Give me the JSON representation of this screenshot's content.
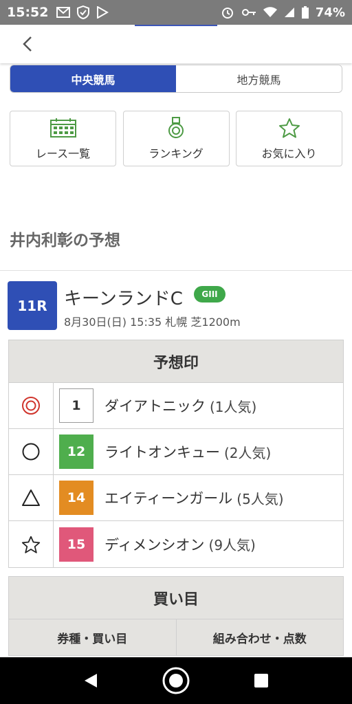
{
  "status_bar": {
    "time": "15:52",
    "battery": "74%",
    "icons": [
      "mail-icon",
      "shield-check-icon",
      "play-store-icon",
      "alarm-icon",
      "key-icon",
      "wifi-icon",
      "signal-icon",
      "battery-icon"
    ]
  },
  "app_bar": {
    "back_icon": "chevron-left-icon"
  },
  "segment": {
    "active_label": "中央競馬",
    "inactive_label": "地方競馬"
  },
  "quick_buttons": [
    {
      "label": "レース一覧",
      "icon": "calendar-icon"
    },
    {
      "label": "ランキング",
      "icon": "medal-icon"
    },
    {
      "label": "お気に入り",
      "icon": "star-outline-icon"
    }
  ],
  "section_title": "井内利彰の予想",
  "race": {
    "number": "11R",
    "name": "キーンランドC",
    "grade": "GIII",
    "meta": "8月30日(日) 15:35 札幌 芝1200m",
    "badge_color": "#2f4fb5",
    "grade_color": "#3fa84a"
  },
  "prediction": {
    "title": "予想印",
    "rows": [
      {
        "mark": "double-circle-icon",
        "number": "1",
        "horse": "ダイアトニック",
        "popularity": "(1人気)",
        "num_bg": "#ffffff",
        "num_fg": "#333333"
      },
      {
        "mark": "circle-icon",
        "number": "12",
        "horse": "ライトオンキュー",
        "popularity": "(2人気)",
        "num_bg": "#4fae4d",
        "num_fg": "#ffffff"
      },
      {
        "mark": "triangle-icon",
        "number": "14",
        "horse": "エイティーンガール",
        "popularity": "(5人気)",
        "num_bg": "#e38c22",
        "num_fg": "#ffffff"
      },
      {
        "mark": "star-icon",
        "number": "15",
        "horse": "ディメンシオン",
        "popularity": "(9人気)",
        "num_bg": "#e0587a",
        "num_fg": "#ffffff"
      }
    ]
  },
  "buy": {
    "title": "買い目",
    "columns": [
      "券種・買い目",
      "組み合わせ・点数"
    ]
  },
  "nav_bar": {
    "icons": [
      "back-icon",
      "home-icon",
      "recents-icon"
    ]
  }
}
